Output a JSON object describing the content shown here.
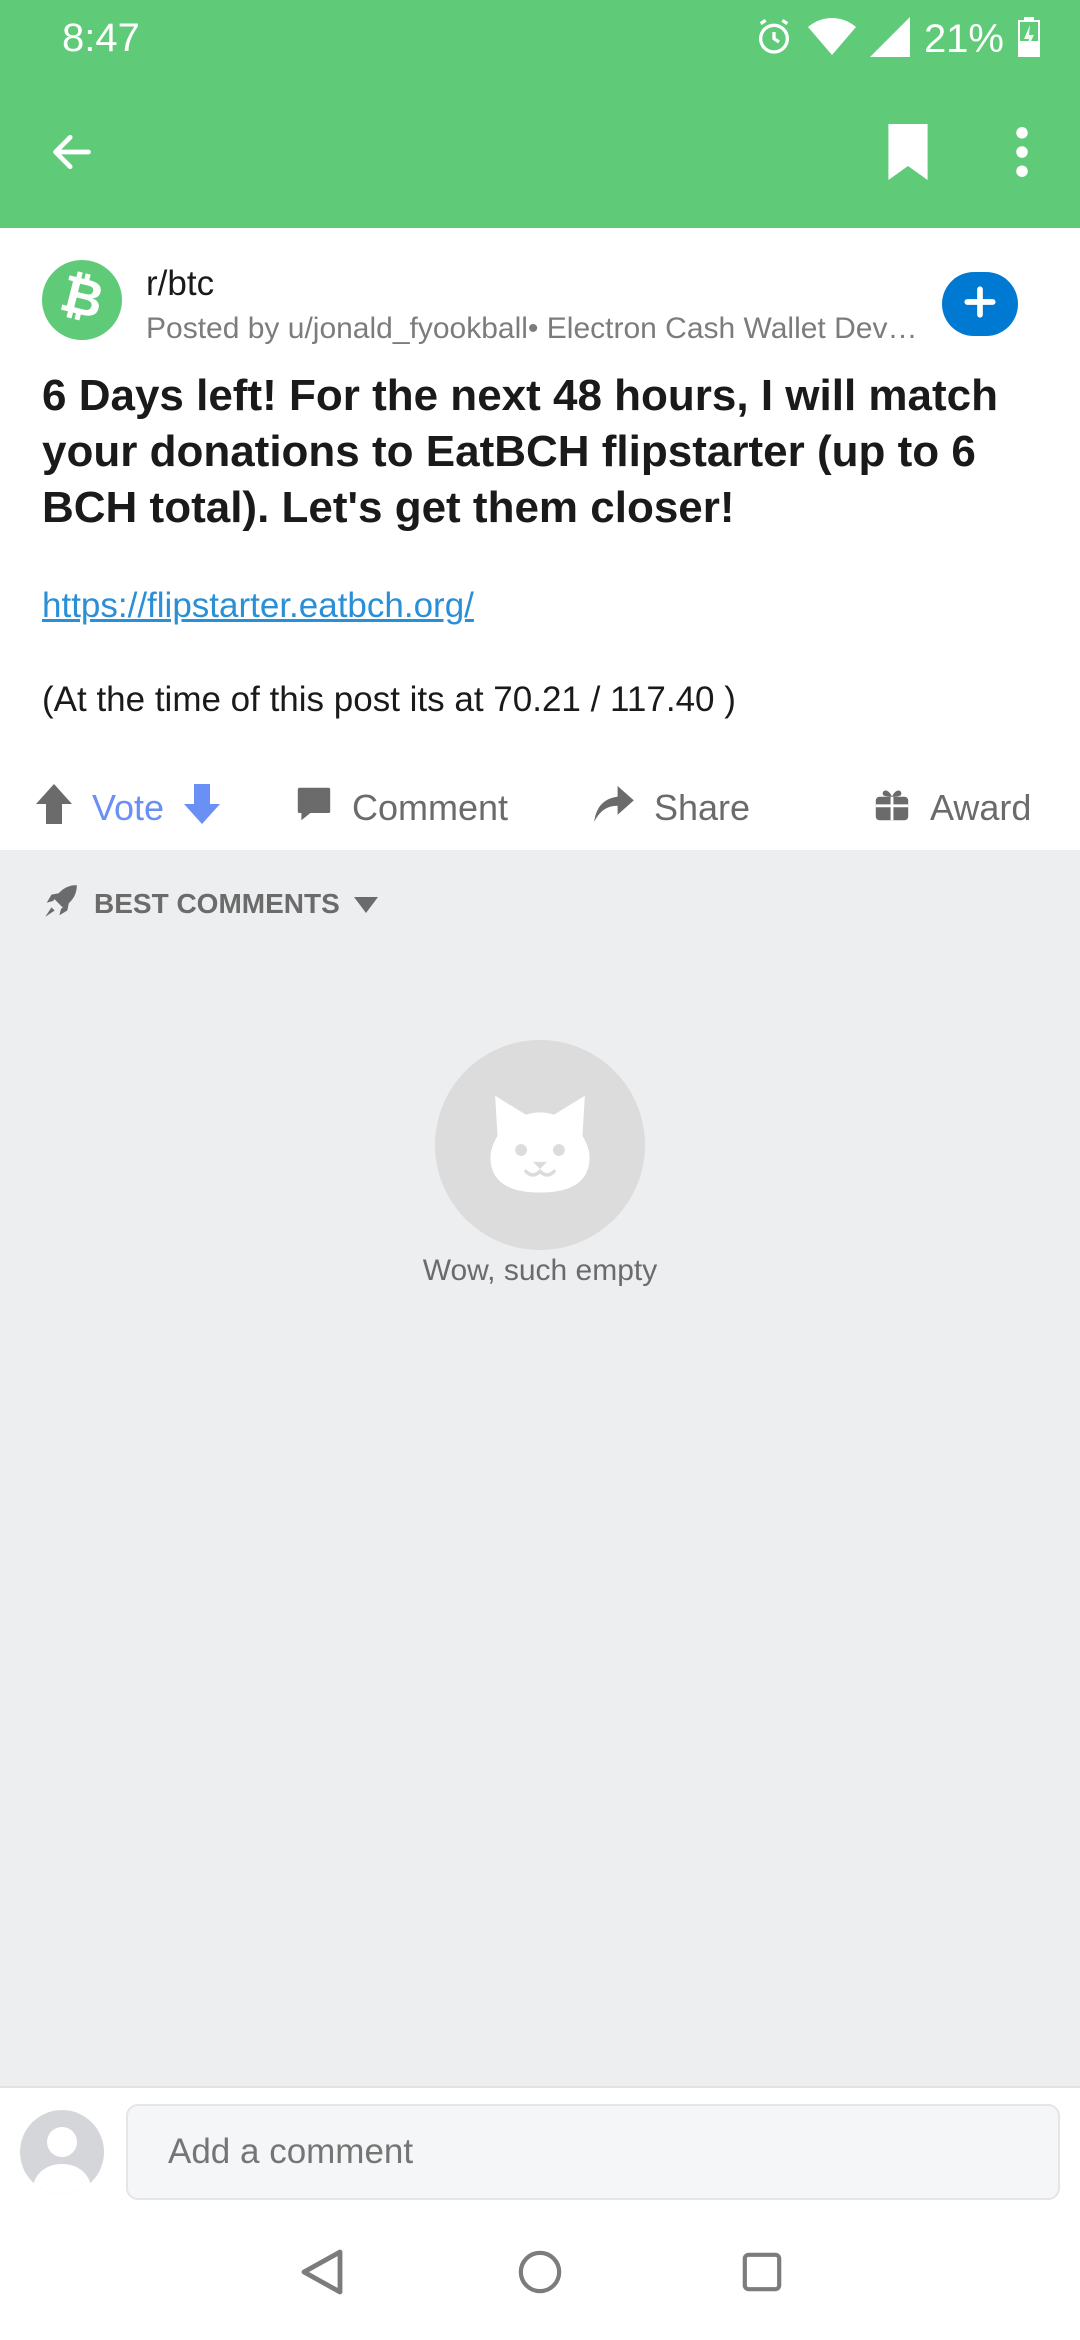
{
  "status_bar": {
    "time": "8:47",
    "battery_percent": "21%",
    "icons": [
      "alarm-icon",
      "wifi-icon",
      "signal-icon",
      "battery-charging-icon"
    ]
  },
  "app_bar": {
    "back_icon": "arrow-left-icon",
    "bookmark_icon": "bookmark-icon",
    "more_icon": "more-vertical-icon"
  },
  "post": {
    "subreddit": "r/btc",
    "posted_by": "Posted by u/jonald_fyookball• Electron Cash Wallet Developer",
    "title": "6 Days left! For the next 48 hours, I will match your donations to EatBCH flipstarter (up to 6 BCH total). Let's get them closer!",
    "link": "https://flipstarter.eatbch.org/",
    "body": "(At the time of this post its at 70.21 / 117.40 )",
    "join_icon": "plus-icon"
  },
  "actions": {
    "vote_label": "Vote",
    "comment_label": "Comment",
    "share_label": "Share",
    "award_label": "Award"
  },
  "comments": {
    "sort_label": "BEST COMMENTS",
    "empty_text": "Wow, such empty"
  },
  "comment_bar": {
    "placeholder": "Add a comment"
  },
  "colors": {
    "brand_green": "#5fcb78",
    "link_blue": "#2a8fd6",
    "join_blue": "#0079d3",
    "downvote_blue": "#6a8ff5"
  }
}
